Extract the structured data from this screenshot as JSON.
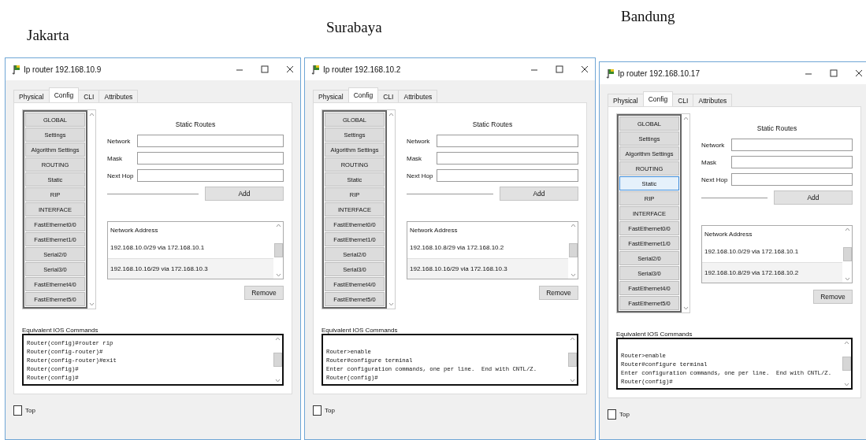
{
  "windows": [
    {
      "caption": "Jakarta",
      "title": "Ip router 192.168.10.9",
      "tabs": [
        {
          "label": "Physical",
          "selected": false
        },
        {
          "label": "Config",
          "selected": true
        },
        {
          "label": "CLI",
          "selected": false
        },
        {
          "label": "Attributes",
          "selected": false
        }
      ],
      "sidebar": [
        {
          "label": "GLOBAL",
          "selected": false
        },
        {
          "label": "Settings",
          "selected": false
        },
        {
          "label": "Algorithm Settings",
          "selected": false
        },
        {
          "label": "ROUTING",
          "selected": false
        },
        {
          "label": "Static",
          "selected": false
        },
        {
          "label": "RIP",
          "selected": false
        },
        {
          "label": "INTERFACE",
          "selected": false
        },
        {
          "label": "FastEthernet0/0",
          "selected": false
        },
        {
          "label": "FastEthernet1/0",
          "selected": false
        },
        {
          "label": "Serial2/0",
          "selected": false
        },
        {
          "label": "Serial3/0",
          "selected": false
        },
        {
          "label": "FastEthernet4/0",
          "selected": false
        },
        {
          "label": "FastEthernet5/0",
          "selected": false
        }
      ],
      "static_routes": {
        "title": "Static Routes",
        "fields": [
          {
            "label": "Network"
          },
          {
            "label": "Mask"
          },
          {
            "label": "Next Hop"
          }
        ],
        "add_button": "Add",
        "list_header": "Network Address",
        "routes": [
          "192.168.10.0/29 via 172.168.10.1",
          "192.168.10.16/29 via 172.168.10.3"
        ],
        "remove_button": "Remove"
      },
      "commands_label": "Equivalent IOS Commands",
      "commands": [
        "Router(config)#router rip",
        "Router(config-router)#",
        "Router(config-router)#exit",
        "Router(config)#",
        "Router(config)#"
      ],
      "top_checkbox": {
        "label": "Top",
        "checked": false
      }
    },
    {
      "caption": "Surabaya",
      "title": "Ip router 192.168.10.2",
      "tabs": [
        {
          "label": "Physical",
          "selected": false
        },
        {
          "label": "Config",
          "selected": true
        },
        {
          "label": "CLI",
          "selected": false
        },
        {
          "label": "Attributes",
          "selected": false
        }
      ],
      "sidebar": [
        {
          "label": "GLOBAL",
          "selected": false
        },
        {
          "label": "Settings",
          "selected": false
        },
        {
          "label": "Algorithm Settings",
          "selected": false
        },
        {
          "label": "ROUTING",
          "selected": false
        },
        {
          "label": "Static",
          "selected": false
        },
        {
          "label": "RIP",
          "selected": false
        },
        {
          "label": "INTERFACE",
          "selected": false
        },
        {
          "label": "FastEthernet0/0",
          "selected": false
        },
        {
          "label": "FastEthernet1/0",
          "selected": false
        },
        {
          "label": "Serial2/0",
          "selected": false
        },
        {
          "label": "Serial3/0",
          "selected": false
        },
        {
          "label": "FastEthernet4/0",
          "selected": false
        },
        {
          "label": "FastEthernet5/0",
          "selected": false
        }
      ],
      "static_routes": {
        "title": "Static Routes",
        "fields": [
          {
            "label": "Network"
          },
          {
            "label": "Mask"
          },
          {
            "label": "Next Hop"
          }
        ],
        "add_button": "Add",
        "list_header": "Network Address",
        "routes": [
          "192.168.10.8/29 via 172.168.10.2",
          "192.168.10.16/29 via 172.168.10.3"
        ],
        "remove_button": "Remove"
      },
      "commands_label": "Equivalent IOS Commands",
      "commands": [
        "Router>enable",
        "Router#configure terminal",
        "Enter configuration commands, one per line.  End with CNTL/Z.",
        "Router(config)#"
      ],
      "top_checkbox": {
        "label": "Top",
        "checked": false
      }
    },
    {
      "caption": "Bandung",
      "title": "Ip router 192.168.10.17",
      "tabs": [
        {
          "label": "Physical",
          "selected": false
        },
        {
          "label": "Config",
          "selected": true
        },
        {
          "label": "CLI",
          "selected": false
        },
        {
          "label": "Attributes",
          "selected": false
        }
      ],
      "sidebar": [
        {
          "label": "GLOBAL",
          "selected": false
        },
        {
          "label": "Settings",
          "selected": false
        },
        {
          "label": "Algorithm Settings",
          "selected": false
        },
        {
          "label": "ROUTING",
          "selected": false
        },
        {
          "label": "Static",
          "selected": true
        },
        {
          "label": "RIP",
          "selected": false
        },
        {
          "label": "INTERFACE",
          "selected": false
        },
        {
          "label": "FastEthernet0/0",
          "selected": false
        },
        {
          "label": "FastEthernet1/0",
          "selected": false
        },
        {
          "label": "Serial2/0",
          "selected": false
        },
        {
          "label": "Serial3/0",
          "selected": false
        },
        {
          "label": "FastEthernet4/0",
          "selected": false
        },
        {
          "label": "FastEthernet5/0",
          "selected": false
        }
      ],
      "static_routes": {
        "title": "Static Routes",
        "fields": [
          {
            "label": "Network"
          },
          {
            "label": "Mask"
          },
          {
            "label": "Next Hop"
          }
        ],
        "add_button": "Add",
        "list_header": "Network Address",
        "routes": [
          "192.168.10.0/29 via 172.168.10.1",
          "192.168.10.8/29 via 172.168.10.2"
        ],
        "remove_button": "Remove"
      },
      "commands_label": "Equivalent IOS Commands",
      "commands": [
        "Router>enable",
        "Router#configure terminal",
        "Enter configuration commands, one per line.  End with CNTL/Z.",
        "Router(config)#"
      ],
      "top_checkbox": {
        "label": "Top",
        "checked": false
      }
    }
  ]
}
